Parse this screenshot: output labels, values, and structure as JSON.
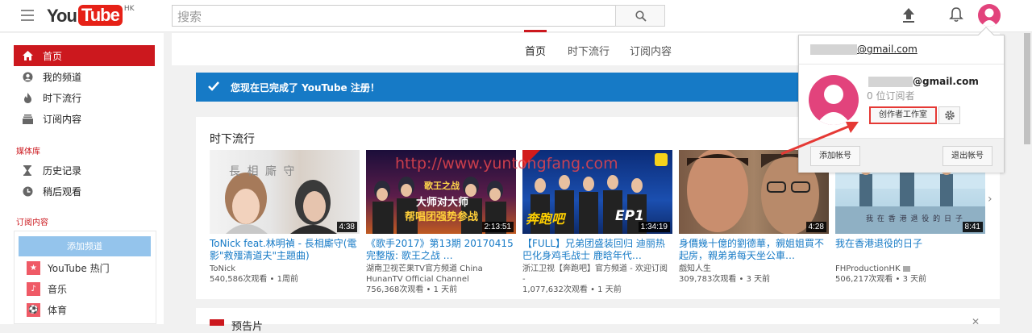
{
  "header": {
    "logo_you": "You",
    "logo_tube": "Tube",
    "logo_region": "HK",
    "search_placeholder": "搜索"
  },
  "sidebar": {
    "items": [
      {
        "label": "首页",
        "active": true
      },
      {
        "label": "我的频道"
      },
      {
        "label": "时下流行"
      },
      {
        "label": "订阅内容"
      }
    ],
    "library_title": "媒体库",
    "library": [
      {
        "label": "历史记录"
      },
      {
        "label": "稍后观看"
      }
    ],
    "subs_title": "订阅内容",
    "add_channel": "添加频道",
    "subs": [
      {
        "label": "YouTube 热门"
      },
      {
        "label": "音乐"
      },
      {
        "label": "体育"
      }
    ]
  },
  "tabs": [
    {
      "label": "首页",
      "active": true
    },
    {
      "label": "时下流行"
    },
    {
      "label": "订阅内容"
    }
  ],
  "banner": {
    "text": "您现在已完成了 YouTube 注册！"
  },
  "shelf": {
    "title": "时下流行",
    "videos": [
      {
        "title": "ToNick feat.林明禎 - 長相廝守(電影\"救殭清道夫\"主題曲)",
        "channel": "ToNick",
        "meta": "540,586次观看 • 1周前",
        "duration": "4:38"
      },
      {
        "title": "《歌手2017》第13期 20170415完整版: 歌王之战 …",
        "channel": "湖南卫视芒果TV官方频道 China HunanTV Official Channel",
        "meta": "756,368次观看 • 1 天前",
        "duration": "2:13:51"
      },
      {
        "title": "【FULL】兄弟团盛装回归 迪丽热巴化身鸡毛战士 鹿晗年代…",
        "channel": "浙江卫视【奔跑吧】官方频道 - 欢迎订阅 -",
        "meta": "1,077,632次观看 • 1 天前",
        "duration": "1:34:19"
      },
      {
        "title": "身價幾十億的劉德華，親姐姐買不起房，親弟弟每天坐公車…",
        "channel": "戲知人生",
        "meta": "309,783次观看 • 3 天前",
        "duration": "4:28"
      },
      {
        "title": "我在香港退役的日子",
        "channel": "FHProductionHK",
        "meta": "506,217次观看 • 3 天前",
        "duration": "8:41"
      }
    ]
  },
  "shelf2": {
    "title": "预告片"
  },
  "watermark": "http://www.yuntongfang.com",
  "account_menu": {
    "email_top": "@gmail.com",
    "email": "@gmail.com",
    "subscribers": "0 位订阅者",
    "studio_button": "创作者工作室",
    "add_account": "添加帐号",
    "sign_out": "退出帐号"
  },
  "thumb_texts": {
    "t1": "長 相 廝 守",
    "t2a": "歌王之战",
    "t2b": "大师对大师",
    "t2c": "帮唱团强势参战",
    "t3": "奔跑吧",
    "t3ep": "EP1",
    "t5": "我 在 香 港 退 役 的 日 子"
  },
  "colors": {
    "brand_red": "#cc181e",
    "link_blue": "#167ac6",
    "banner_blue": "#167ac6",
    "avatar_pink": "#e2437c"
  }
}
